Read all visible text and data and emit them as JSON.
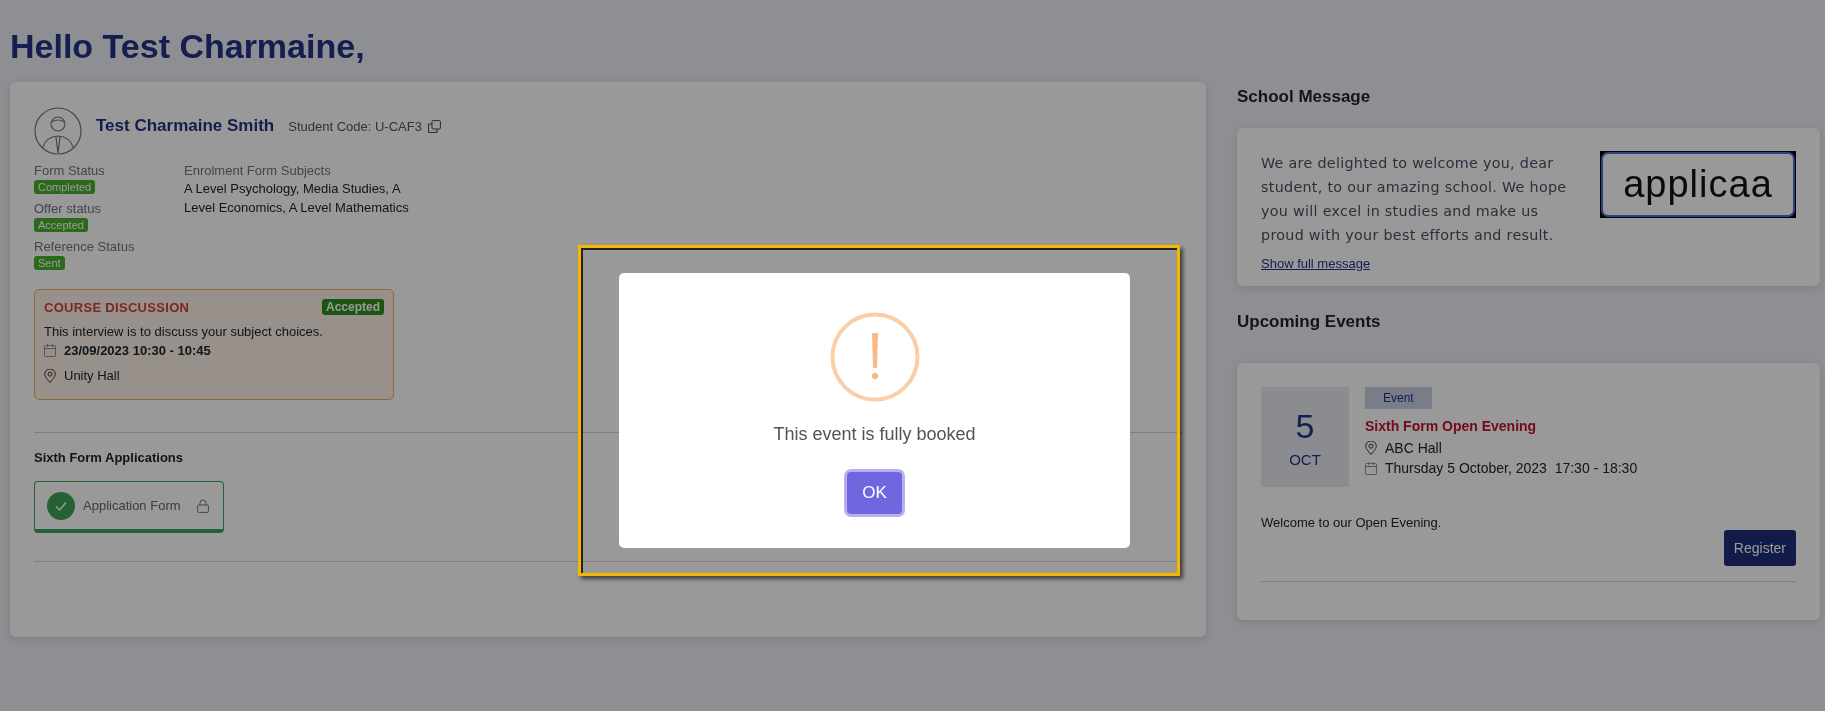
{
  "greeting": "Hello Test Charmaine,",
  "student": {
    "name": "Test Charmaine Smith",
    "code": "Student Code: U-CAF3",
    "statuses": [
      {
        "label": "Form Status",
        "value": "Completed"
      },
      {
        "label": "Offer status",
        "value": "Accepted"
      },
      {
        "label": "Reference Status",
        "value": "Sent"
      }
    ],
    "subjects_label": "Enrolment Form Subjects",
    "subjects": "A Level Psychology, Media Studies, A Level Economics, A Level Mathematics"
  },
  "interview": {
    "title": "COURSE DISCUSSION",
    "status": "Accepted",
    "description": "This interview is to discuss your subject choices.",
    "datetime": "23/09/2023 10:30 - 10:45",
    "location": "Unity Hall"
  },
  "applications": {
    "title": "Sixth Form Applications",
    "items": [
      {
        "label": "Application Form",
        "completed": true,
        "locked": true
      }
    ]
  },
  "school_message": {
    "title": "School Message",
    "text": "We are delighted to welcome you, dear student, to our amazing school. We hope you will excel in studies and make us proud with your best efforts and result.",
    "logo_text": "applicaa",
    "link": "Show full message"
  },
  "events": {
    "title": "Upcoming Events",
    "items": [
      {
        "day": "5",
        "month": "OCT",
        "tag": "Event",
        "title": "Sixth Form Open Evening",
        "location": "ABC Hall",
        "datetime": "Thursday 5 October, 2023  17:30 - 18:30",
        "description": "Welcome to our Open Evening.",
        "button": "Register"
      }
    ]
  },
  "dialog": {
    "message": "This event is fully booked",
    "button": "OK"
  }
}
